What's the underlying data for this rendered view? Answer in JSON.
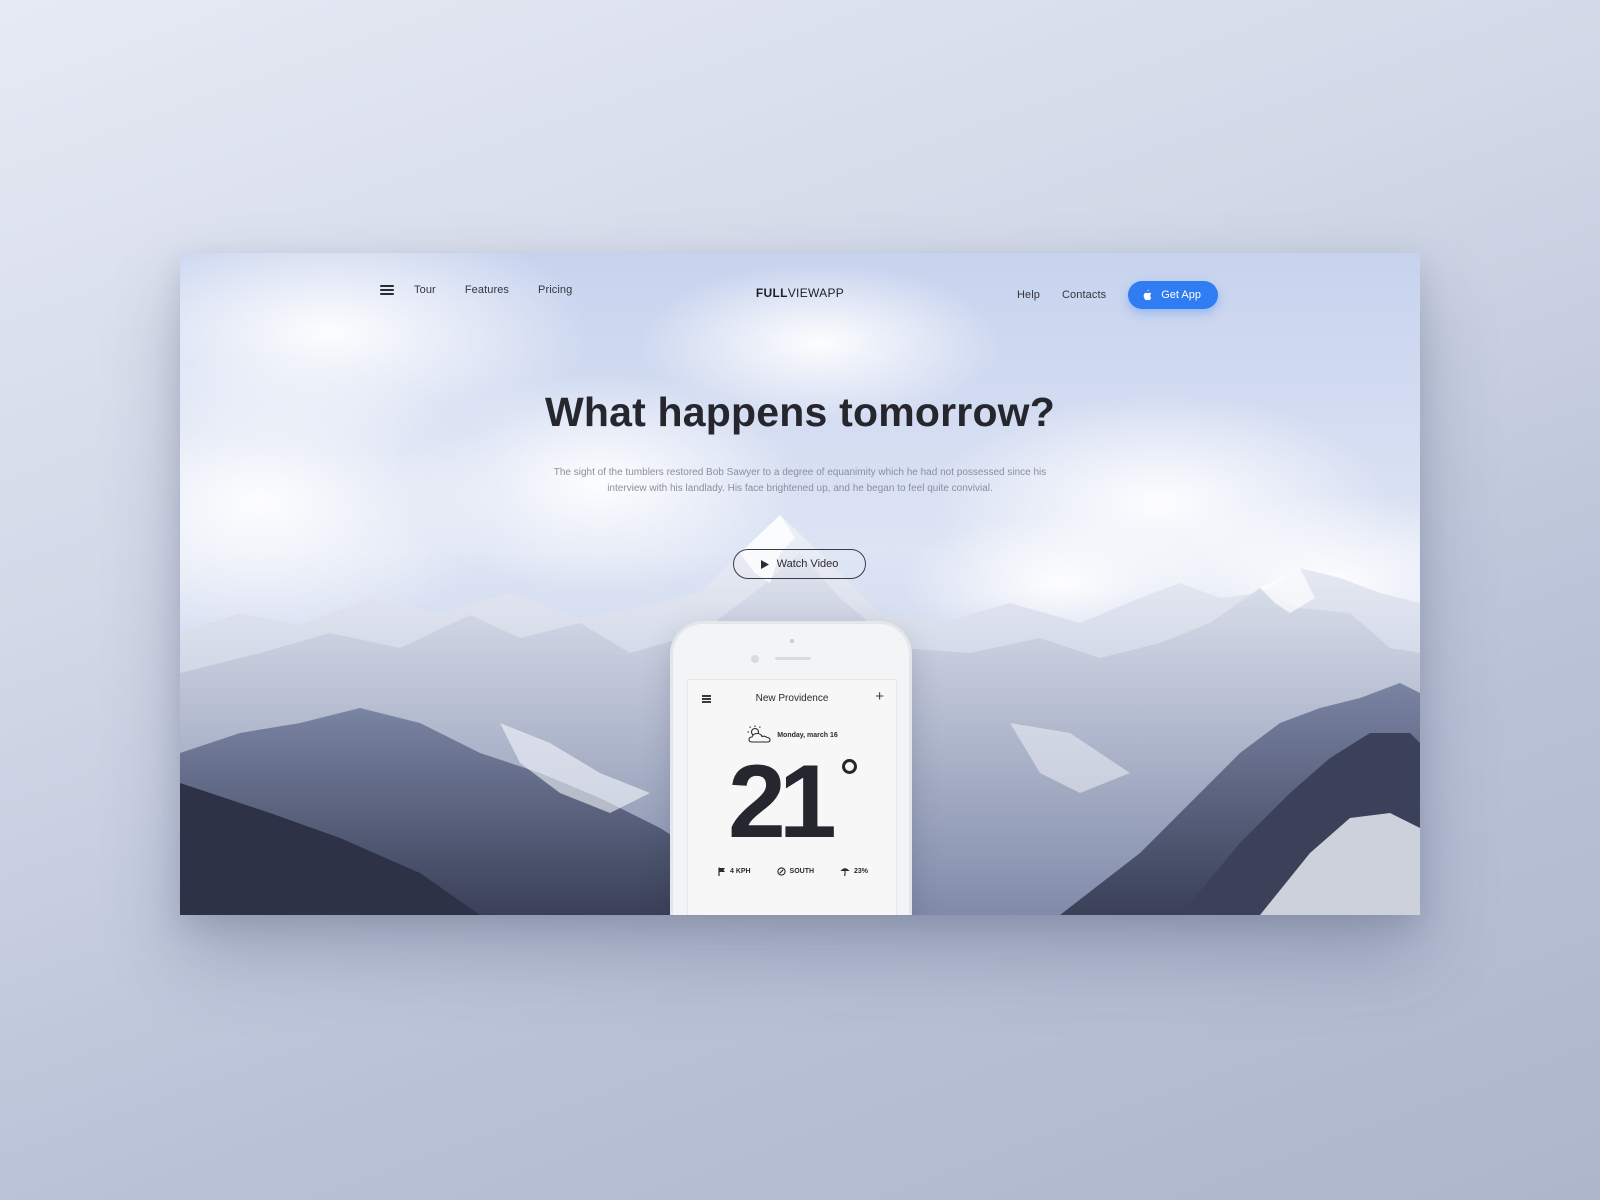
{
  "nav": {
    "links_left": [
      "Tour",
      "Features",
      "Pricing"
    ],
    "brand_bold": "FULL",
    "brand_rest": "VIEWAPP",
    "links_right": [
      "Help",
      "Contacts"
    ],
    "cta_label": "Get App",
    "cta_color": "#2f7cf3"
  },
  "hero": {
    "title": "What happens tomorrow?",
    "subtitle": "The sight of the tumblers restored Bob Sawyer to a degree of equanimity which he had not possessed since his interview with his landlady. His face brightened up, and he began to feel quite convivial.",
    "watch_label": "Watch Video"
  },
  "phone": {
    "city": "New Providence",
    "date": "Monday, march 16",
    "temperature": "21",
    "stats": [
      {
        "icon": "flag-icon",
        "value": "4 KPH"
      },
      {
        "icon": "compass-icon",
        "value": "SOUTH"
      },
      {
        "icon": "umbrella-icon",
        "value": "23%"
      }
    ],
    "weather_icon": "partly-cloudy-icon"
  }
}
